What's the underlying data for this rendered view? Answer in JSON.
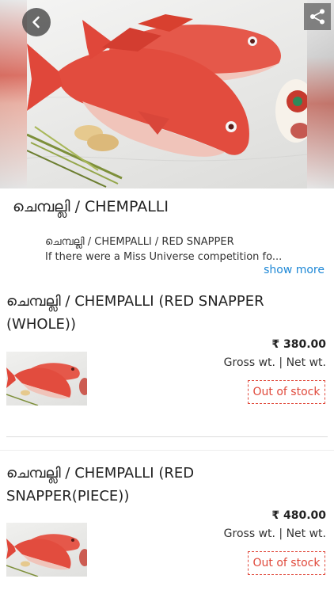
{
  "header": {
    "back_icon": "chevron-left-icon",
    "share_icon": "share-icon"
  },
  "category": {
    "title": "ചെമ്പല്ലി / CHEMPALLI",
    "description_line1": "ചെമ്പല്ലി / CHEMPALLI / RED SNAPPER",
    "description_line2": "If there were a Miss Universe competition fo...",
    "show_more": "show more"
  },
  "products": [
    {
      "name_line1": "ചെമ്പല്ലി / CHEMPALLI (RED SNAPPER",
      "name_line2": "(WHOLE))",
      "price": "₹ 380.00",
      "weights": "Gross wt.  | Net wt.",
      "status": "Out of stock"
    },
    {
      "name_line1": "ചെമ്പല്ലി / CHEMPALLI (RED",
      "name_line2": "SNAPPER(PIECE))",
      "price": "₹ 480.00",
      "weights": "Gross wt.  | Net wt.",
      "status": "Out of stock"
    }
  ],
  "colors": {
    "accent_link": "#1e88d6",
    "out_of_stock": "#e0493b",
    "fish_red": "#d9463a"
  }
}
